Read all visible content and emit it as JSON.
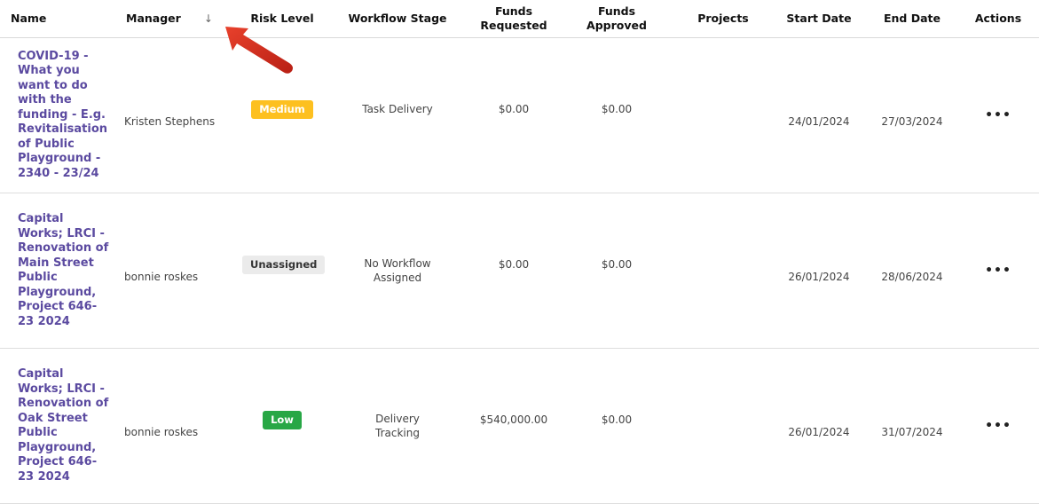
{
  "columns": {
    "name": "Name",
    "manager": "Manager",
    "risk": "Risk Level",
    "workflow": "Workflow Stage",
    "funds_requested_1": "Funds",
    "funds_requested_2": "Requested",
    "funds_approved_1": "Funds",
    "funds_approved_2": "Approved",
    "projects": "Projects",
    "start": "Start Date",
    "end": "End Date",
    "actions": "Actions"
  },
  "sort_icon": "↓",
  "icons": {
    "sort": "arrow-down-icon",
    "actions": "more-horizontal-icon",
    "annotation": "red-pointer-arrow"
  },
  "colors": {
    "medium": "#fdc020",
    "low": "#28a745",
    "unassigned": "#ebebeb",
    "link": "#5b4aa0",
    "annotation": "#d22b1f"
  },
  "rows": [
    {
      "name": "COVID-19 - What you want to do with the funding - E.g. Revitalisation of Public Playground - 2340 - 23/24",
      "manager": "Kristen Stephens",
      "risk": "Medium",
      "workflow_1": "Task Delivery",
      "workflow_2": "",
      "funds_requested": "$0.00",
      "funds_approved": "$0.00",
      "projects": "",
      "start": "24/01/2024",
      "end": "27/03/2024",
      "actions": "•••"
    },
    {
      "name": "Capital Works; LRCI - Renovation of Main Street Public Playground, Project 646-23 2024",
      "manager": "bonnie roskes",
      "risk": "Unassigned",
      "workflow_1": "No Workflow",
      "workflow_2": "Assigned",
      "funds_requested": "$0.00",
      "funds_approved": "$0.00",
      "projects": "",
      "start": "26/01/2024",
      "end": "28/06/2024",
      "actions": "•••"
    },
    {
      "name": "Capital Works; LRCI - Renovation of Oak Street Public Playground, Project 646-23 2024",
      "manager": "bonnie roskes",
      "risk": "Low",
      "workflow_1": "Delivery",
      "workflow_2": "Tracking",
      "funds_requested": "$540,000.00",
      "funds_approved": "$0.00",
      "projects": "",
      "start": "26/01/2024",
      "end": "31/07/2024",
      "actions": "•••"
    }
  ]
}
